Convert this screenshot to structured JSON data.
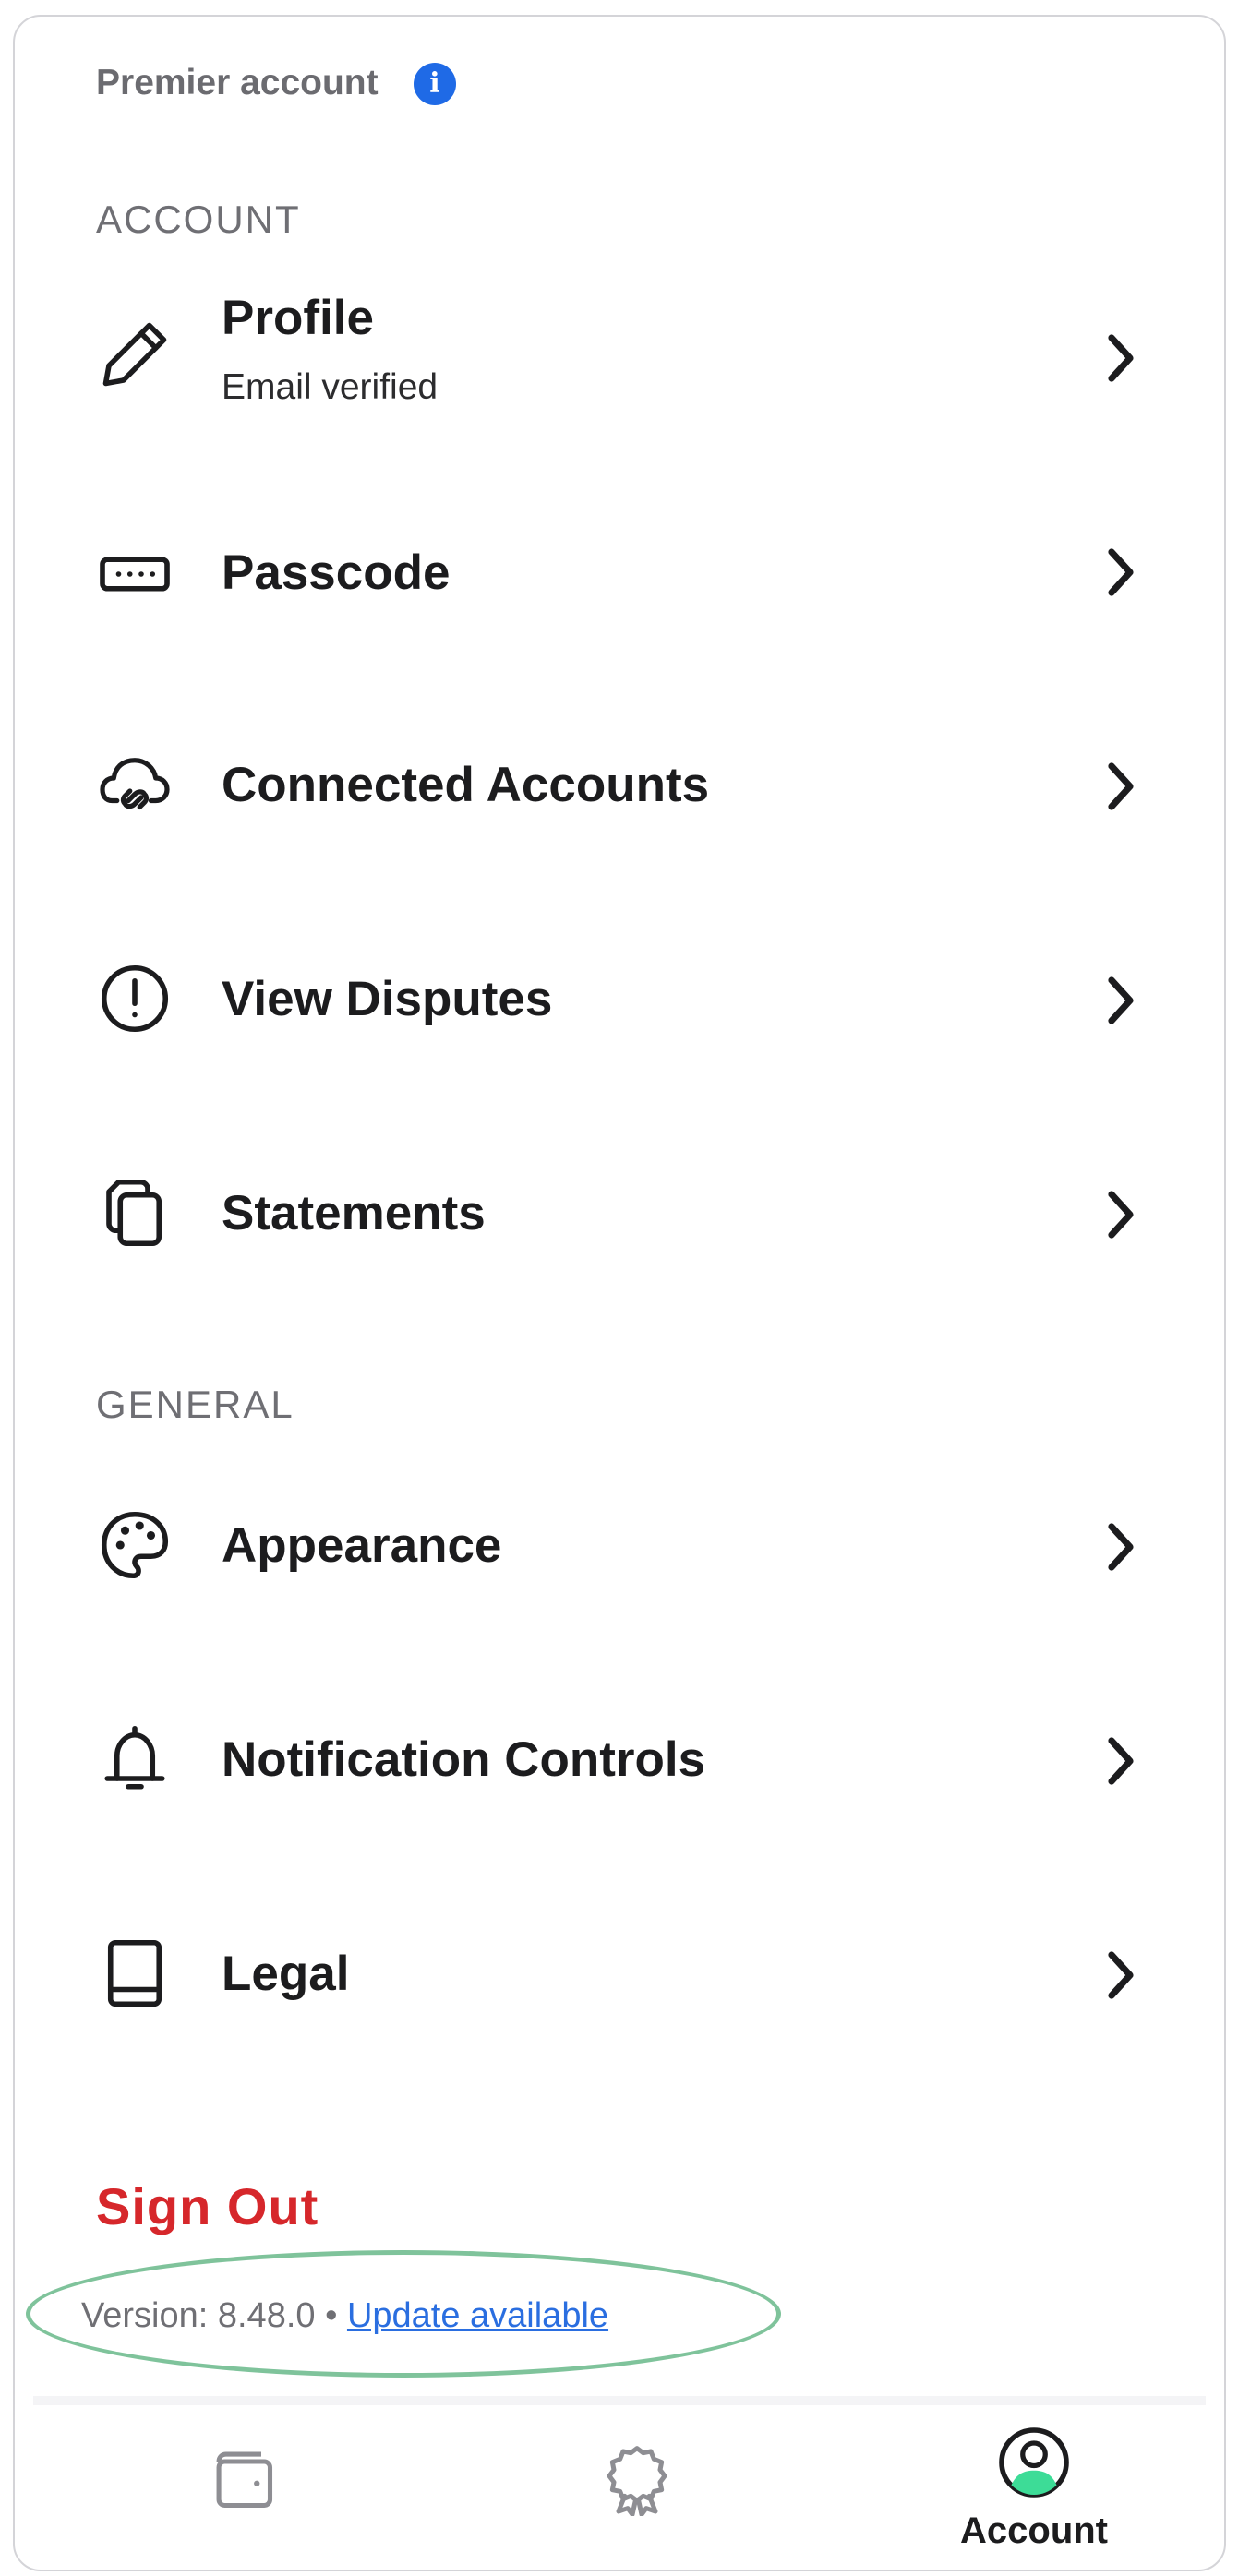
{
  "header": {
    "premier_label": "Premier account",
    "info_icon": "info-icon"
  },
  "sections": [
    {
      "heading": "ACCOUNT",
      "items": [
        {
          "label": "Profile",
          "subtitle": "Email verified",
          "icon": "pencil-icon"
        },
        {
          "label": "Passcode",
          "icon": "keypad-icon"
        },
        {
          "label": "Connected Accounts",
          "icon": "cloud-link-icon"
        },
        {
          "label": "View Disputes",
          "icon": "exclamation-circle-icon"
        },
        {
          "label": "Statements",
          "icon": "documents-icon"
        }
      ]
    },
    {
      "heading": "GENERAL",
      "items": [
        {
          "label": "Appearance",
          "icon": "palette-icon"
        },
        {
          "label": "Notification Controls",
          "icon": "bell-icon"
        },
        {
          "label": "Legal",
          "icon": "book-icon"
        }
      ]
    }
  ],
  "sign_out_label": "Sign Out",
  "version": {
    "prefix": "Version: 8.48.0 •",
    "link_label": "Update available"
  },
  "tabbar": {
    "tabs": [
      {
        "icon": "wallet-icon",
        "label": ""
      },
      {
        "icon": "award-icon",
        "label": ""
      },
      {
        "icon": "account-icon",
        "label": "Account",
        "active": true
      }
    ]
  },
  "colors": {
    "accent_green": "#3ddc97",
    "sign_out_red": "#d6272b",
    "link_blue": "#2a6ee0",
    "info_blue": "#1f6ae6",
    "highlight_ellipse": "#7fc39b"
  }
}
